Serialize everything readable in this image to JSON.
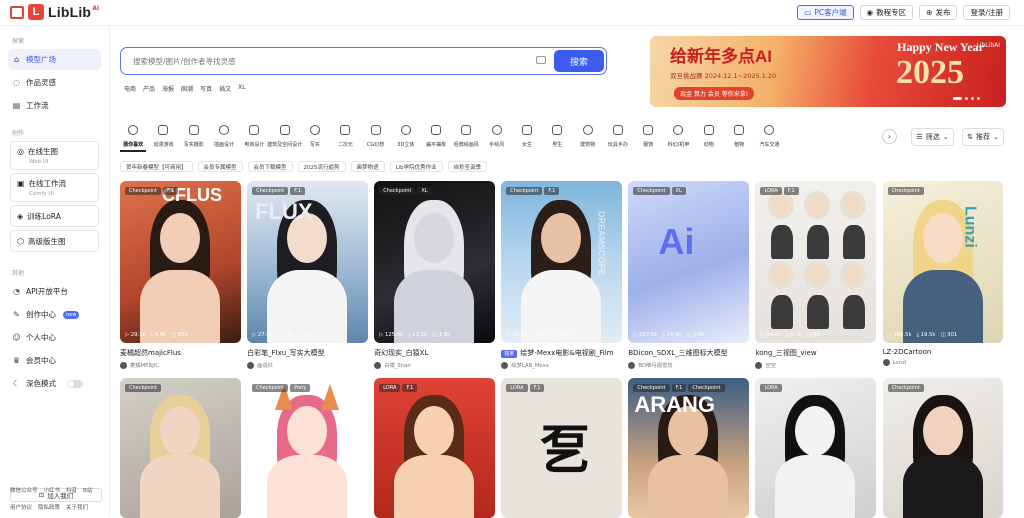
{
  "header": {
    "logo_text": "LibLib",
    "logo_sup": "AI",
    "buttons": [
      "PC客户端",
      "教程专区",
      "发布",
      "登录/注册"
    ]
  },
  "sidebar": {
    "section_explore": "探索",
    "explore_items": [
      "模型广场",
      "作品灵感",
      "工作流"
    ],
    "section_create": "创作",
    "create_cards": [
      {
        "title": "在线生图",
        "sub": "Web UI"
      },
      {
        "title": "在线工作流",
        "sub": "Comfy UI"
      }
    ],
    "create_items": [
      "训练LoRA",
      "高级版生图"
    ],
    "section_more": "其他",
    "more_items": [
      "API开放平台",
      "创作中心",
      "个人中心",
      "会员中心",
      "深色模式"
    ],
    "new_badge": "new",
    "join_label": "加入我们",
    "footer_row1": [
      "微信公众号",
      "小红书",
      "抖音",
      "B站"
    ],
    "footer_row2": [
      "用户协议",
      "隐私政策",
      "关于我们"
    ]
  },
  "search": {
    "placeholder": "搜索模型/图片/创作者寻找灵感",
    "button": "搜索",
    "quick_tags": [
      "电商",
      "产品",
      "海报",
      "国潮",
      "写真",
      "插文",
      "XL"
    ]
  },
  "banner": {
    "title": "给新年多点AI",
    "brand": "LibLibAI",
    "subtitle": "双旦挑战赛  2024.12.1~2025.1.20",
    "cta": "现金 算力 会员 等你来拿!",
    "en": "Happy New Year",
    "year": "2025"
  },
  "categories": [
    "猜你喜欢",
    "动漫游戏",
    "写实摄影",
    "插画设计",
    "电商设计",
    "建筑及空间设计",
    "写实",
    "二次元",
    "CG幻想",
    "3D立体",
    "扁平抽象",
    "经典绘画风",
    "手绘风",
    "女生",
    "男生",
    "建筑物",
    "玩具手办",
    "服饰",
    "科幻/机甲",
    "动物",
    "植物",
    "汽车交通"
  ],
  "filters": {
    "filter": "筛选",
    "sort": "推荐"
  },
  "chips": [
    "贺年新春模型【可商用】",
    "会员专属模型",
    "会员下载模型",
    "2025流行趋势",
    "画梦物语",
    "Lib学院优秀作业",
    "自秒圣诞季"
  ],
  "cards_row1": [
    {
      "tags": [
        "Checkpoint",
        "F.1"
      ],
      "stats": [
        "29.1k",
        "4.8k",
        "892"
      ],
      "title": "麦橘超然majicFlus",
      "author": "麦橘MERJIC"
    },
    {
      "tags": [
        "Checkpoint",
        "F.1"
      ],
      "stats": [
        "27.6k",
        "2.7k",
        "472"
      ],
      "title": "白彩笔_Flxu_写实大模型",
      "author": "画说红"
    },
    {
      "tags": [
        "Checkpoint",
        "XL"
      ],
      "stats": [
        "125.8k",
        "13.2k",
        "1.9k"
      ],
      "title": "奇幻现实_白猿XL",
      "author": "白猿_Shan"
    },
    {
      "tags": [
        "Checkpoint",
        "F.1"
      ],
      "stats": [
        "16.7k",
        "1.5k",
        "1.1k"
      ],
      "title": "绘梦-Mexx电影&电视剧_Film",
      "author": "绘梦LAB_Mexx",
      "badge": "独家"
    },
    {
      "tags": [
        "Checkpoint",
        "XL"
      ],
      "stats": [
        "257.5k",
        "14.4k",
        "1.0k"
      ],
      "title": "BDicon_SDXL_三维图标大模型",
      "author": "BD唯丹视觉坊"
    },
    {
      "tags": [
        "LORA",
        "F.1"
      ],
      "stats": [
        "34.2k",
        "3.7k",
        "86"
      ],
      "title": "kong_三视图_view",
      "author": "空空"
    },
    {
      "tags": [
        "Checkpoint"
      ],
      "stats": [
        "165.5k",
        "19.5k",
        "301"
      ],
      "title": "LZ-2DCartoon",
      "author": "Lunzi"
    }
  ],
  "cards_row2": [
    {
      "tags": [
        "Checkpoint"
      ]
    },
    {
      "tags": [
        "Checkpoint",
        "Pony"
      ]
    },
    {
      "tags": [
        "LORA",
        "F.1"
      ]
    },
    {
      "tags": [
        "LORA",
        "F.1"
      ]
    },
    {
      "tags": [
        "Checkpoint",
        "F.1",
        "Checkpoint"
      ]
    },
    {
      "tags": [
        "LORA"
      ]
    },
    {
      "tags": [
        "Checkpoint"
      ]
    }
  ],
  "art_text": {
    "c1": "CFLUS",
    "c2": "FLUX",
    "c4": "DREAMSCOPE",
    "c5": "Ai",
    "c7": "Lunzi",
    "r2c4": "乭",
    "r2c5": "ARANG"
  }
}
